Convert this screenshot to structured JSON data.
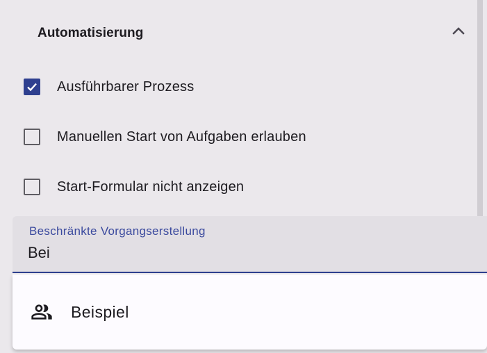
{
  "section": {
    "title": "Automatisierung",
    "expanded": true
  },
  "checkboxes": [
    {
      "label": "Ausführbarer Prozess",
      "checked": true
    },
    {
      "label": "Manuellen Start von Aufgaben erlauben",
      "checked": false
    },
    {
      "label": "Start-Formular nicht anzeigen",
      "checked": false
    }
  ],
  "restricted_creation": {
    "label": "Beschränkte Vorgangserstellung",
    "value": "Bei"
  },
  "autocomplete": {
    "options": [
      {
        "label": "Beispiel",
        "icon": "group-icon"
      }
    ]
  },
  "colors": {
    "accent": "#2e3f8f",
    "label_accent": "#3b4a9e",
    "background": "#ebe8ec",
    "field_background": "#e2dfe4",
    "menu_background": "#fdfbff"
  }
}
